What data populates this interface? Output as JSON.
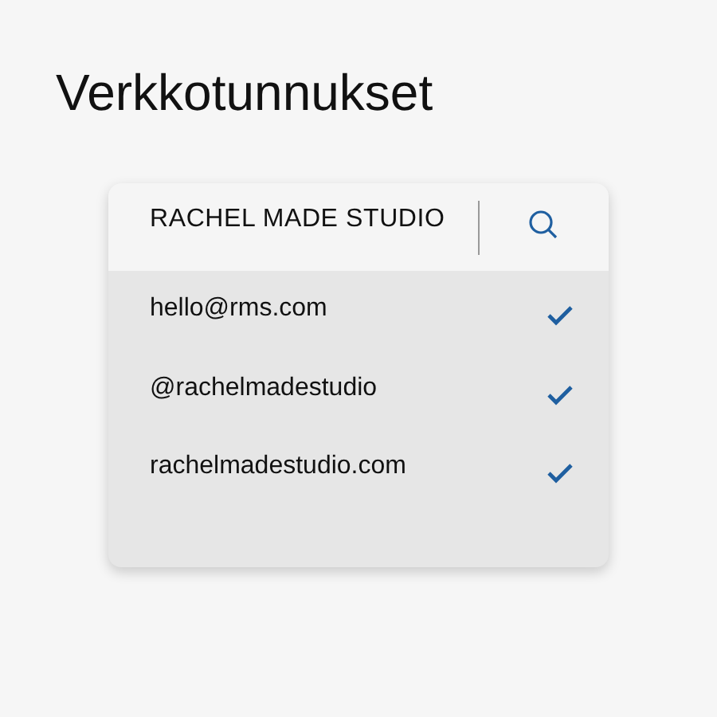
{
  "title": "Verkkotunnukset",
  "card": {
    "header": "RACHEL MADE STUDIO",
    "items": [
      {
        "label": "hello@rms.com",
        "checked": true
      },
      {
        "label": "@rachelmadestudio",
        "checked": true
      },
      {
        "label": "rachelmadestudio.com",
        "checked": true
      }
    ]
  }
}
